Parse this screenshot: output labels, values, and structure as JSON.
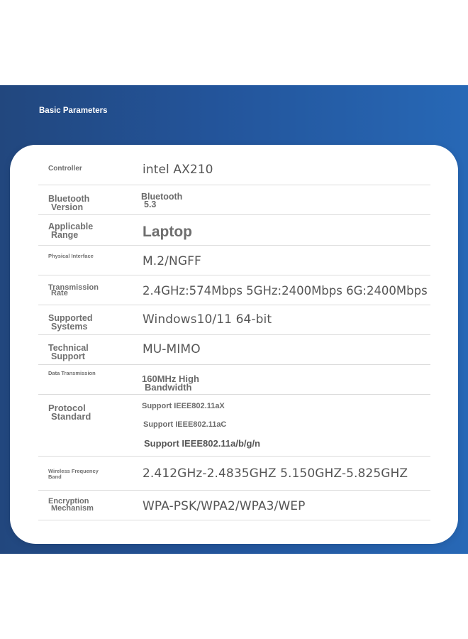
{
  "section_title": "Basic Parameters",
  "rows": [
    {
      "label_1": "Controller",
      "value": "intel AX210"
    },
    {
      "label_1": "Bluetooth",
      "label_2": "Version",
      "value_1": "Bluetooth",
      "value_2": "5.3"
    },
    {
      "label_1": "Applicable",
      "label_2": "Range",
      "value": "Laptop"
    },
    {
      "label_1": "Physical Interface",
      "value": "M.2/NGFF"
    },
    {
      "label_1": "Transmission",
      "label_2": "Rate",
      "value": "2.4GHz:574Mbps 5GHz:2400Mbps 6G:2400Mbps"
    },
    {
      "label_1": "Supported",
      "label_2": "Systems",
      "value": "Windows10/11 64-bit"
    },
    {
      "label_1": "Technical",
      "label_2": "Support",
      "value": "MU-MIMO"
    },
    {
      "label_1": "Data Transmission",
      "value_1": "160MHz High",
      "value_2": "Bandwidth"
    },
    {
      "label_1": "Protocol",
      "label_2": "Standard",
      "values": [
        "Support IEEE802.11aX",
        "Support IEEE802.11aC",
        "Support IEEE802.11a/b/g/n"
      ]
    },
    {
      "label_1": "Wireless Frequency",
      "label_2": "Band",
      "value": "2.412GHz-2.4835GHZ 5.150GHZ-5.825GHZ"
    },
    {
      "label_1": "Encryption",
      "label_2": "Mechanism",
      "value": "WPA-PSK/WPA2/WPA3/WEP"
    }
  ]
}
